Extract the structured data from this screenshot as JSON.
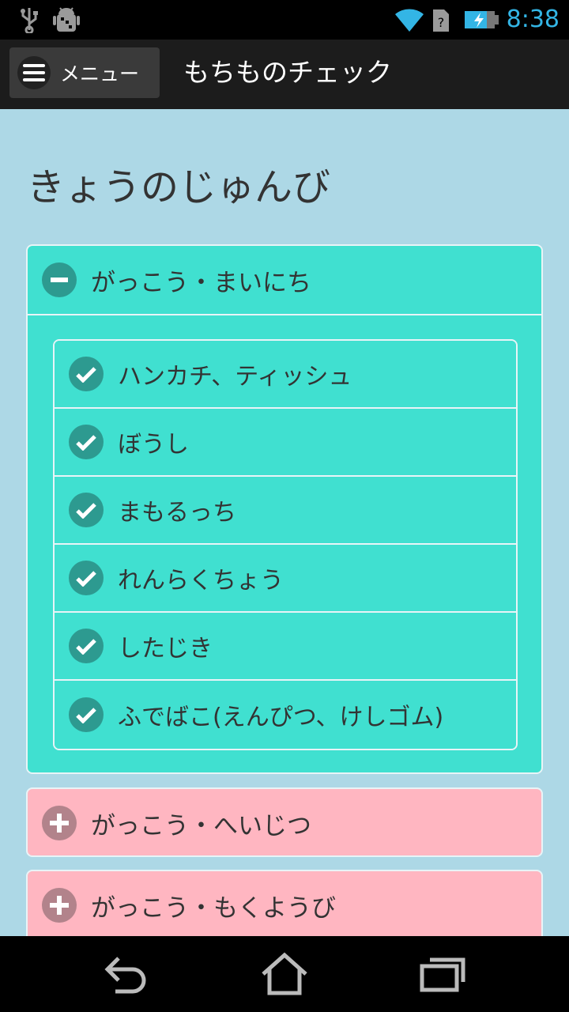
{
  "status_bar": {
    "time": "8:38",
    "icons": [
      "usb-icon",
      "android-debug-icon",
      "wifi-icon",
      "no-sim-icon",
      "battery-charging-icon"
    ],
    "accent_color": "#33b5e5"
  },
  "header": {
    "menu_label": "メニュー",
    "title": "もちものチェック"
  },
  "main": {
    "section_title": "きょうのじゅんび",
    "groups": [
      {
        "title": "がっこう・まいにち",
        "expanded": true,
        "color": "#40e0d0",
        "items": [
          {
            "label": "ハンカチ、ティッシュ",
            "checked": true
          },
          {
            "label": "ぼうし",
            "checked": true
          },
          {
            "label": "まもるっち",
            "checked": true
          },
          {
            "label": "れんらくちょう",
            "checked": true
          },
          {
            "label": "したじき",
            "checked": true
          },
          {
            "label": "ふでばこ(えんぴつ、けしゴム)",
            "checked": true
          }
        ]
      },
      {
        "title": "がっこう・へいじつ",
        "expanded": false,
        "color": "#ffb6c1"
      },
      {
        "title": "がっこう・もくようび",
        "expanded": false,
        "color": "#ffb6c1"
      }
    ]
  },
  "nav_bar": {
    "icons": [
      "back-icon",
      "home-icon",
      "recent-apps-icon"
    ]
  }
}
